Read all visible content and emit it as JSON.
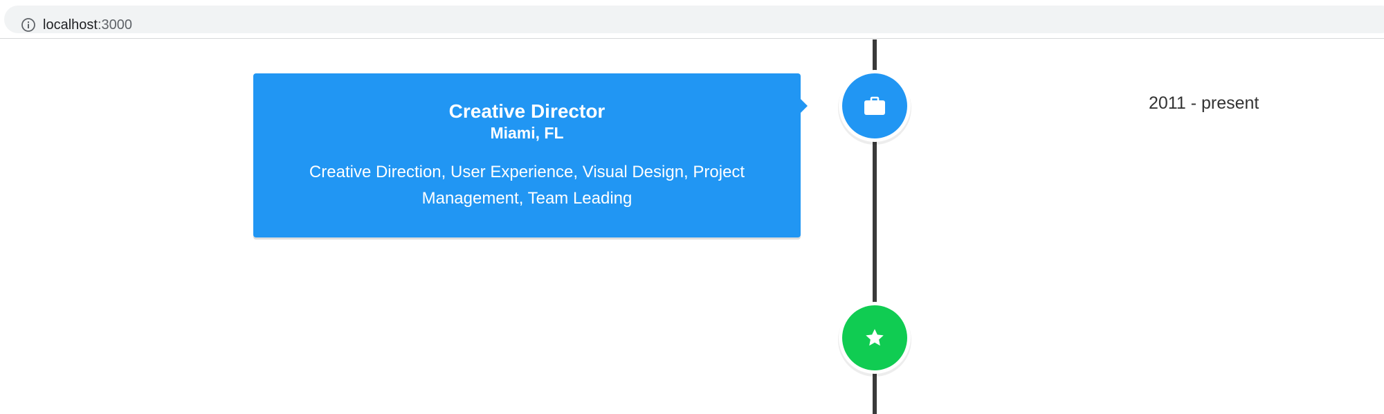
{
  "browser": {
    "url_host": "localhost",
    "url_port": ":3000",
    "info_icon": "info-icon"
  },
  "timeline": {
    "elements": [
      {
        "title": "Creative Director",
        "subtitle": "Miami, FL",
        "description": "Creative Direction, User Experience, Visual Design, Project Management, Team Leading",
        "date": "2011 - present",
        "icon": "briefcase-icon",
        "icon_color": "#2196f3",
        "card_color": "#2196f3"
      }
    ],
    "end_icon": "star-icon",
    "end_icon_color": "#10cc52",
    "line_color": "#3a3a3a"
  }
}
